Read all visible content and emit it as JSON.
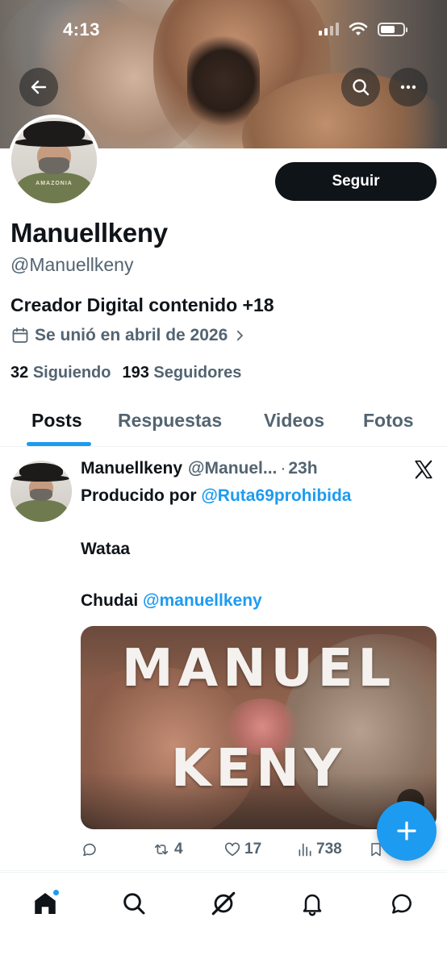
{
  "status_bar": {
    "time": "4:13",
    "battery_level": 0.55
  },
  "header": {
    "back_icon": "arrow-left-icon",
    "search_icon": "search-icon",
    "more_icon": "more-horizontal-icon"
  },
  "profile": {
    "avatar_shirt_text": "AMAZONIA",
    "follow_label": "Seguir",
    "display_name": "Manuellkeny",
    "handle": "@Manuellkeny",
    "bio": "Creador Digital contenido +18",
    "joined": "Se unió en abril de 2026",
    "following_count": "32",
    "following_label": "Siguiendo",
    "followers_count": "193",
    "followers_label": "Seguidores"
  },
  "tabs": [
    {
      "label": "Posts",
      "active": true
    },
    {
      "label": "Respuestas",
      "active": false
    },
    {
      "label": "Videos",
      "active": false
    },
    {
      "label": "Fotos",
      "active": false
    }
  ],
  "post": {
    "author": "Manuellkeny",
    "handle": "@Manuel...",
    "separator": "·",
    "time": "23h",
    "line1_prefix": "Producido por ",
    "line1_mention": "@Ruta69prohibida",
    "line2": "Wataa",
    "line3_prefix": "Chudai ",
    "line3_mention": "@manuellkeny",
    "media_title_line1": "MANUEL",
    "media_title_line2": "KENY",
    "actions": {
      "reply_count": "",
      "repost_count": "4",
      "like_count": "17",
      "views_count": "738"
    }
  },
  "bottom_nav": [
    "home-icon",
    "search-icon",
    "grok-icon",
    "notifications-icon",
    "messages-icon"
  ],
  "colors": {
    "accent": "#1d9bf0",
    "text": "#0f1419",
    "muted": "#536471"
  }
}
